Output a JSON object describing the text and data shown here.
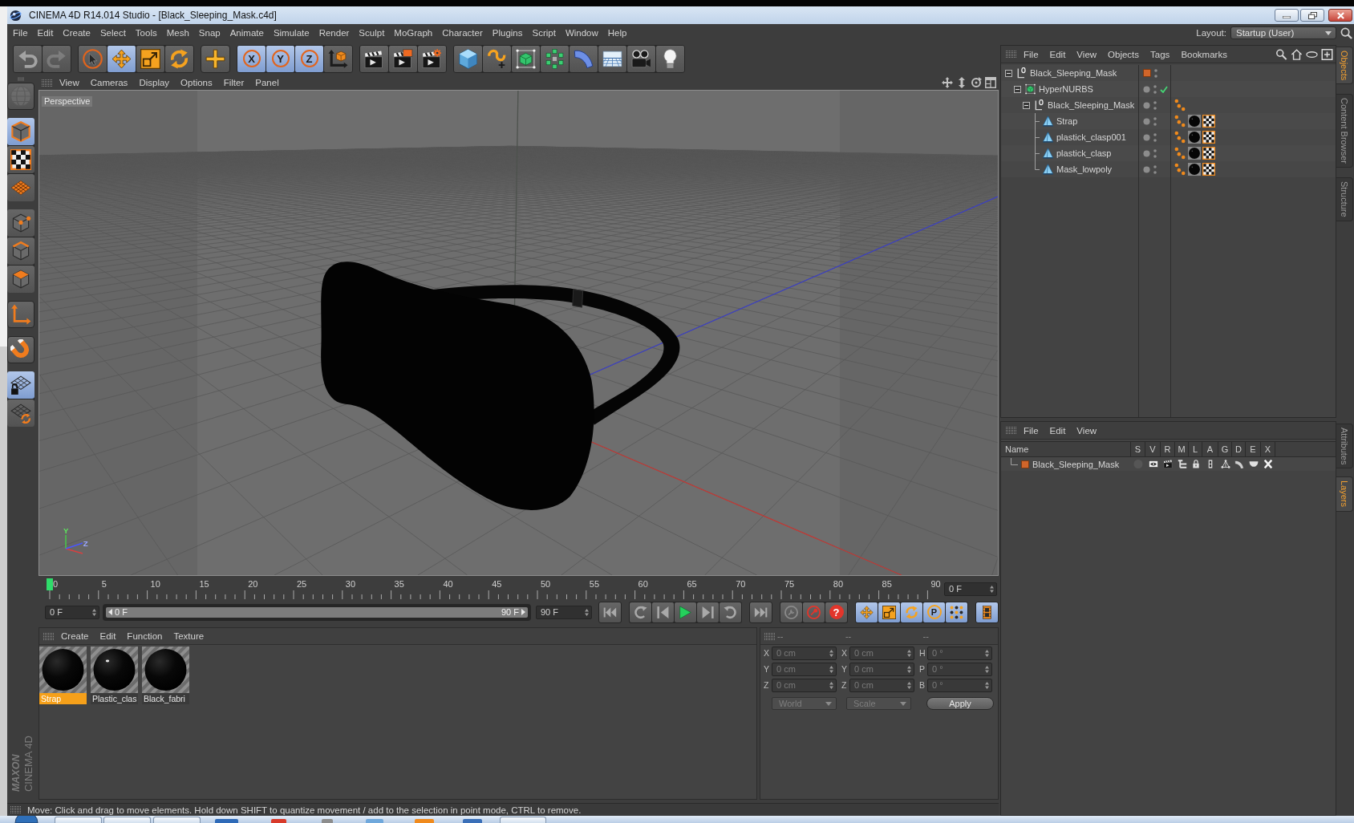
{
  "window": {
    "title": "CINEMA 4D R14.014 Studio - [Black_Sleeping_Mask.c4d]"
  },
  "menu_bar": [
    "File",
    "Edit",
    "Create",
    "Select",
    "Tools",
    "Mesh",
    "Snap",
    "Animate",
    "Simulate",
    "Render",
    "Sculpt",
    "MoGraph",
    "Character",
    "Plugins",
    "Script",
    "Window",
    "Help"
  ],
  "layout": {
    "label": "Layout:",
    "value": "Startup (User)"
  },
  "toolbar": [
    [
      {
        "kind": "undo",
        "selected": false,
        "disabled": false
      },
      {
        "kind": "redo",
        "selected": false,
        "disabled": true
      }
    ],
    [
      {
        "kind": "select",
        "selected": false
      },
      {
        "kind": "move",
        "selected": true
      },
      {
        "kind": "scale",
        "selected": false
      },
      {
        "kind": "rotate",
        "selected": false
      }
    ],
    [
      {
        "kind": "recent",
        "selected": false
      }
    ],
    [
      {
        "kind": "axis",
        "label": "X",
        "selected": true
      },
      {
        "kind": "axis",
        "label": "Y",
        "selected": true
      },
      {
        "kind": "axis",
        "label": "Z",
        "selected": true
      },
      {
        "kind": "coords",
        "selected": false
      }
    ],
    [
      {
        "kind": "render_view",
        "selected": false
      },
      {
        "kind": "render_pv",
        "selected": false
      },
      {
        "kind": "render_settings",
        "selected": false
      }
    ],
    [
      {
        "kind": "cube",
        "selected": false
      },
      {
        "kind": "pen",
        "selected": false
      },
      {
        "kind": "subdivision",
        "selected": false
      },
      {
        "kind": "cloner",
        "selected": false
      },
      {
        "kind": "bend",
        "selected": false
      },
      {
        "kind": "floor",
        "selected": false
      },
      {
        "kind": "camera",
        "selected": false
      },
      {
        "kind": "light",
        "selected": false
      }
    ]
  ],
  "tool_palette": [
    [
      {
        "kind": "make_editable",
        "selected": false,
        "disabled": true
      }
    ],
    [
      {
        "kind": "model",
        "selected": true
      },
      {
        "kind": "texture",
        "selected": false
      },
      {
        "kind": "workplane",
        "selected": false
      }
    ],
    [
      {
        "kind": "points",
        "selected": false
      },
      {
        "kind": "edges",
        "selected": false
      },
      {
        "kind": "polygons",
        "selected": false
      }
    ],
    [
      {
        "kind": "axis_mode",
        "selected": false
      }
    ],
    [
      {
        "kind": "snap",
        "selected": false
      }
    ],
    [
      {
        "kind": "workplane_lock",
        "selected": true
      },
      {
        "kind": "workplane_sync",
        "selected": false
      }
    ]
  ],
  "viewport": {
    "menu": [
      "View",
      "Cameras",
      "Display",
      "Options",
      "Filter",
      "Panel"
    ],
    "camera": "Perspective",
    "axis_labels": [
      "Y",
      "Z"
    ]
  },
  "timeline": {
    "ticks": [
      "0",
      "5",
      "10",
      "15",
      "20",
      "25",
      "30",
      "35",
      "40",
      "45",
      "50",
      "55",
      "60",
      "65",
      "70",
      "75",
      "80",
      "85",
      "90"
    ],
    "level": 0,
    "current": "0 F",
    "start": "0 F",
    "range": {
      "from": "0 F",
      "to": "90 F",
      "level": 1
    },
    "end": "90 F"
  },
  "transport": [
    [
      {
        "kind": "skip_start",
        "selected": false
      }
    ],
    [
      {
        "kind": "prev_key",
        "selected": false
      },
      {
        "kind": "prev_frame",
        "selected": false
      },
      {
        "kind": "play",
        "selected": false
      },
      {
        "kind": "next_frame",
        "selected": false
      },
      {
        "kind": "next_key",
        "selected": false
      }
    ],
    [
      {
        "kind": "skip_end",
        "selected": false
      }
    ],
    [
      {
        "kind": "autokey",
        "selected": false
      },
      {
        "kind": "record",
        "selected": false
      },
      {
        "kind": "key_selection",
        "label": "?",
        "selected": false
      }
    ],
    [
      {
        "kind": "key_move",
        "selected": true
      },
      {
        "kind": "key_scale",
        "selected": true
      },
      {
        "kind": "key_rotate",
        "selected": true
      },
      {
        "kind": "key_param",
        "label": "P",
        "selected": true
      },
      {
        "kind": "key_pla",
        "selected": true
      }
    ],
    [
      {
        "kind": "timeline",
        "selected": true
      }
    ]
  ],
  "materials": {
    "menu": [
      "Create",
      "Edit",
      "Function",
      "Texture"
    ],
    "items": [
      {
        "name": "Strap",
        "selected": true,
        "glossy": false
      },
      {
        "name": "Plastic_clas",
        "selected": false,
        "glossy": true
      },
      {
        "name": "Black_fabri",
        "selected": false,
        "glossy": false
      }
    ]
  },
  "branding": [
    "MAXON",
    "CINEMA 4D"
  ],
  "coordinates": {
    "disabled": true,
    "headers": [
      "--",
      "--",
      "--"
    ],
    "rows": [
      [
        {
          "axis": "X",
          "value": "0 cm"
        },
        {
          "axis": "X",
          "value": "0 cm"
        },
        {
          "axis": "H",
          "value": "0 °"
        }
      ],
      [
        {
          "axis": "Y",
          "value": "0 cm"
        },
        {
          "axis": "Y",
          "value": "0 cm"
        },
        {
          "axis": "P",
          "value": "0 °"
        }
      ],
      [
        {
          "axis": "Z",
          "value": "0 cm"
        },
        {
          "axis": "Z",
          "value": "0 cm"
        },
        {
          "axis": "B",
          "value": "0 °"
        }
      ]
    ],
    "mode": "World",
    "transform": "Scale",
    "apply": "Apply"
  },
  "status_bar": {
    "text": "Move: Click and drag to move elements. Hold down SHIFT to quantize movement / add to the selection in point mode, CTRL to remove."
  },
  "object_manager": {
    "menu": [
      "File",
      "Edit",
      "View",
      "Objects",
      "Tags",
      "Bookmarks"
    ],
    "objects": [
      {
        "name": "Black_Sleeping_Mask",
        "kind": "null",
        "selected": false,
        "expanded": true,
        "color": "#d0652a",
        "children": [
          {
            "name": "HyperNURBS",
            "kind": "subdivision",
            "selected": false,
            "expanded": true,
            "enabled": true,
            "children": [
              {
                "name": "Black_Sleeping_Mask",
                "kind": "null",
                "selected": false,
                "expanded": true,
                "tags": [
                  {
                    "kind": "phong"
                  }
                ],
                "children": [
                  {
                    "name": "Strap",
                    "kind": "polygon",
                    "selected": false,
                    "tags": [
                      {
                        "kind": "phong"
                      },
                      {
                        "kind": "material"
                      },
                      {
                        "kind": "uvw"
                      }
                    ]
                  },
                  {
                    "name": "plastick_clasp001",
                    "kind": "polygon",
                    "selected": false,
                    "tags": [
                      {
                        "kind": "phong"
                      },
                      {
                        "kind": "material"
                      },
                      {
                        "kind": "uvw"
                      }
                    ]
                  },
                  {
                    "name": "plastick_clasp",
                    "kind": "polygon",
                    "selected": false,
                    "tags": [
                      {
                        "kind": "phong"
                      },
                      {
                        "kind": "material"
                      },
                      {
                        "kind": "uvw"
                      }
                    ]
                  },
                  {
                    "name": "Mask_lowpoly",
                    "kind": "polygon",
                    "selected": false,
                    "tags": [
                      {
                        "kind": "phong"
                      },
                      {
                        "kind": "material"
                      },
                      {
                        "kind": "uvw"
                      }
                    ]
                  }
                ]
              }
            ]
          }
        ]
      }
    ]
  },
  "layer_manager": {
    "menu": [
      "File",
      "Edit",
      "View"
    ],
    "columns": [
      "Name",
      "S",
      "V",
      "R",
      "M",
      "L",
      "A",
      "G",
      "D",
      "E",
      "X"
    ],
    "layers": [
      {
        "name": "Black_Sleeping_Mask",
        "color": "#d0652a",
        "selected": false,
        "flags": [
          {
            "kind": "solo",
            "on": false
          },
          {
            "kind": "view",
            "on": true
          },
          {
            "kind": "render",
            "on": true
          },
          {
            "kind": "manager",
            "on": true
          },
          {
            "kind": "lock",
            "on": true
          },
          {
            "kind": "animation",
            "on": true
          },
          {
            "kind": "generators",
            "on": true
          },
          {
            "kind": "deformers",
            "on": true
          },
          {
            "kind": "expressions",
            "on": true
          },
          {
            "kind": "xref",
            "on": true
          }
        ]
      }
    ]
  },
  "side_tabs": {
    "upper": [
      {
        "label": "Objects",
        "selected": true
      },
      {
        "label": "Content Browser",
        "selected": false
      },
      {
        "label": "Structure",
        "selected": false
      }
    ],
    "lower": [
      {
        "label": "Attributes",
        "selected": false
      },
      {
        "label": "Layers",
        "selected": true
      }
    ]
  }
}
